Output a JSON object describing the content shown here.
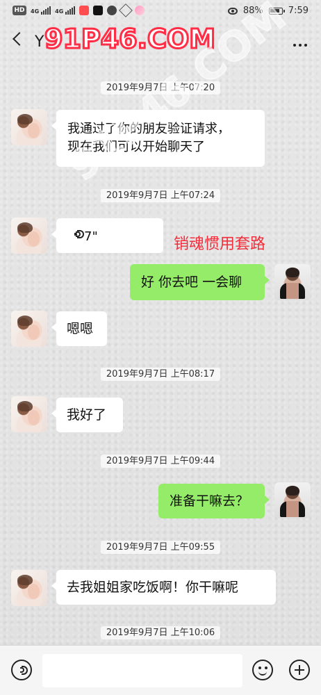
{
  "status_bar": {
    "network_badge": "HD",
    "signal_1": "4G",
    "signal_2": "4G",
    "battery": "88%",
    "time": "7:59"
  },
  "header": {
    "title": "Y"
  },
  "watermarks": {
    "top": "91P46.COM",
    "diagonal": "91P46.COM"
  },
  "messages": [
    {
      "timestamp": "2019年9月7日 上午07:20"
    },
    {
      "text": "我通过了你的朋友验证请求，\n现在我们可以开始聊天了"
    },
    {
      "timestamp": "2019年9月7日 上午07:24"
    },
    {
      "voice_duration": "7\""
    },
    {
      "annotation": "销魂惯用套路"
    },
    {
      "text": "好 你去吧 一会聊"
    },
    {
      "text": "嗯嗯"
    },
    {
      "timestamp": "2019年9月7日 上午08:17"
    },
    {
      "text": "我好了"
    },
    {
      "timestamp": "2019年9月7日 上午09:44"
    },
    {
      "text": "准备干嘛去？"
    },
    {
      "timestamp": "2019年9月7日 上午09:55"
    },
    {
      "text": "去我姐姐家吃饭啊！你干嘛呢"
    },
    {
      "timestamp": "2019年9月7日 上午10:06"
    }
  ],
  "colors": {
    "left_bubble": "#ffffff",
    "right_bubble": "#95ec69",
    "annotation": "#ef2f3c",
    "watermark": "#ff2d45",
    "background": "#e9e9e9"
  },
  "icons": {
    "back": "chevron-left-icon",
    "more": "more-icon",
    "voice": "voice-icon",
    "emoji": "emoji-icon",
    "plus": "plus-icon"
  }
}
